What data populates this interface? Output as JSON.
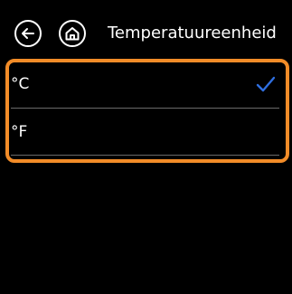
{
  "header": {
    "back_icon": "arrow-left-icon",
    "home_icon": "home-icon",
    "title": "Temperatuureenheid"
  },
  "options": [
    {
      "label": "°C",
      "selected": true
    },
    {
      "label": "°F",
      "selected": false
    }
  ],
  "colors": {
    "background": "#000000",
    "highlight_border": "#f28c28",
    "check_mark": "#2f6fe0",
    "divider": "#6a6a6a"
  },
  "check_icon": "checkmark-icon"
}
